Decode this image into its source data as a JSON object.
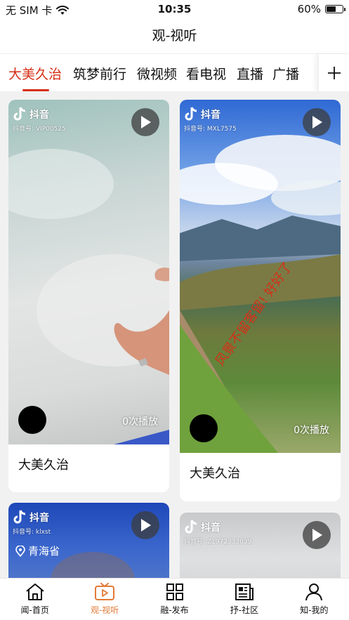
{
  "status_bar": {
    "carrier": "无 SIM 卡",
    "time": "10:35",
    "battery": "60%",
    "battery_level": 0.6
  },
  "page_title": "观-视听",
  "tabs": [
    {
      "label": "大美久治",
      "active": true
    },
    {
      "label": "筑梦前行",
      "active": false
    },
    {
      "label": "微视频",
      "active": false
    },
    {
      "label": "看电视",
      "active": false
    },
    {
      "label": "直播",
      "active": false
    },
    {
      "label": "广播",
      "active": false
    }
  ],
  "cards": [
    {
      "platform": "抖音",
      "account": "抖音号: VIP00525",
      "plays": "0次播放",
      "caption": "大美久治"
    },
    {
      "platform": "抖音",
      "account": "抖音号: MXL7575",
      "plays": "0次播放",
      "caption": "大美久治",
      "overlay_text": "风景不留客留! 好好了"
    },
    {
      "platform": "抖音",
      "account": "抖音号: klxst",
      "location": "青海省"
    },
    {
      "platform": "抖音",
      "account": "抖音号: Z1972333039"
    }
  ],
  "bottom_nav": [
    {
      "label": "闻-首页",
      "icon": "home-icon",
      "active": false
    },
    {
      "label": "观-视听",
      "icon": "tv-play-icon",
      "active": true
    },
    {
      "label": "融-发布",
      "icon": "grid-icon",
      "active": false
    },
    {
      "label": "抒-社区",
      "icon": "newspaper-icon",
      "active": false
    },
    {
      "label": "知-我的",
      "icon": "user-icon",
      "active": false
    }
  ],
  "colors": {
    "accent": "#d62f16",
    "nav_active": "#e27a37"
  }
}
